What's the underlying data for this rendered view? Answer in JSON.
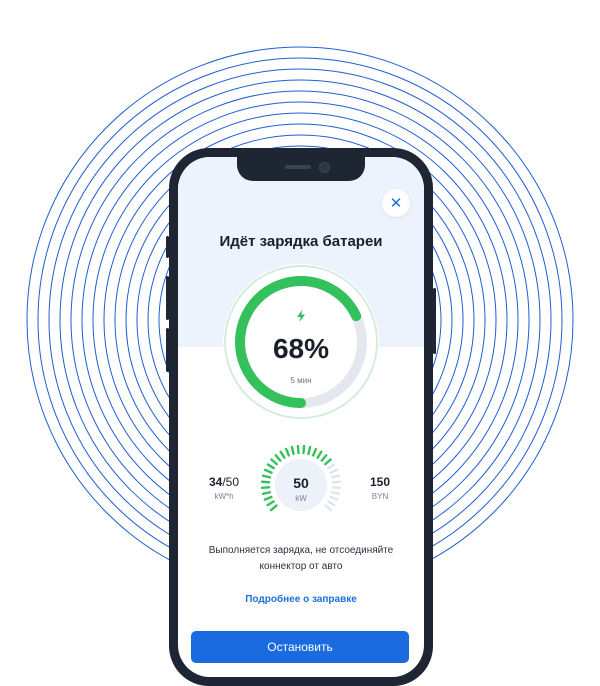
{
  "screen": {
    "close_icon": "close-icon",
    "title": "Идёт зарядка батареи",
    "charge": {
      "percent_text": "68%",
      "percent_value": 68,
      "time_left": "5 мин",
      "icon": "lightning-icon"
    },
    "stats": {
      "energy_value": "34",
      "energy_total": "/50",
      "energy_unit": "kW*h",
      "power_value": "50",
      "power_unit": "kW",
      "cost_value": "150",
      "cost_unit": "BYN",
      "power_level_fraction": 0.7
    },
    "message_line1": "Выполняется зарядка, не отсоединяйте",
    "message_line2": "коннектор от авто",
    "details_link": "Подробнее о заправке",
    "stop_button": "Остановить"
  },
  "colors": {
    "accent_blue": "#1a6ae0",
    "progress_green": "#34c05a",
    "ring_blue": "#1f5fd1",
    "phone_frame": "#1f2633"
  }
}
